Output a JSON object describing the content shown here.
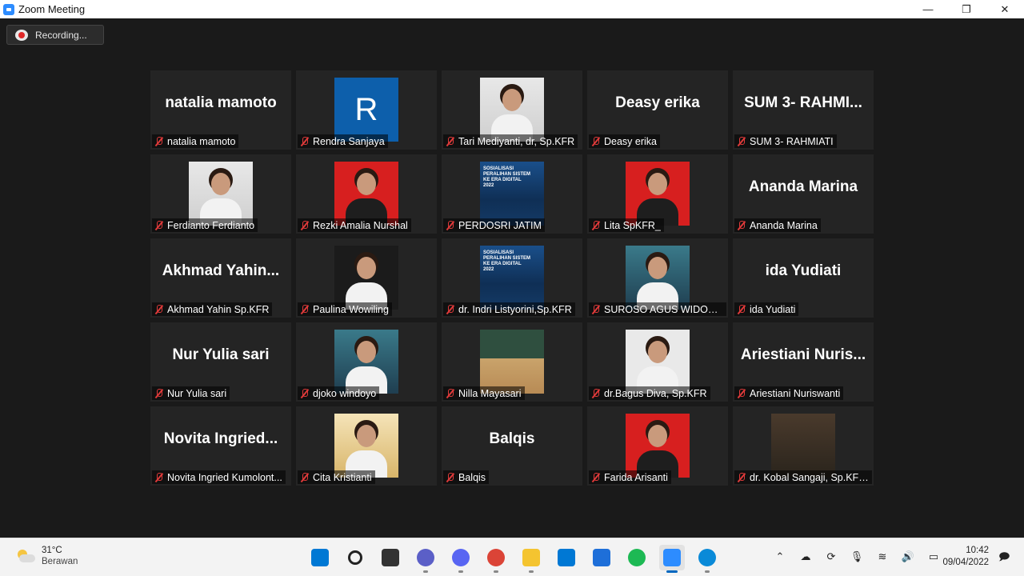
{
  "window": {
    "title": "Zoom Meeting",
    "controls": [
      "—",
      "❐",
      "✕"
    ]
  },
  "recording": {
    "label": "Recording..."
  },
  "participants": [
    {
      "display": "natalia mamoto",
      "name": "natalia mamoto",
      "tile": "text"
    },
    {
      "display": "R",
      "name": "Rendra Sanjaya",
      "tile": "letter"
    },
    {
      "display": "",
      "name": "Tari Mediyanti, dr, Sp.KFR",
      "tile": "photo"
    },
    {
      "display": "Deasy erika",
      "name": "Deasy erika",
      "tile": "text"
    },
    {
      "display": "SUM 3- RAHMI...",
      "name": "SUM 3- RAHMIATI",
      "tile": "text"
    },
    {
      "display": "",
      "name": "Ferdianto Ferdianto",
      "tile": "photo"
    },
    {
      "display": "",
      "name": "Rezki Amalia Nurshal",
      "tile": "photo"
    },
    {
      "display": "",
      "name": "PERDOSRI JATIM",
      "tile": "photo"
    },
    {
      "display": "",
      "name": "Lita SpKFR_",
      "tile": "photo"
    },
    {
      "display": "Ananda Marina",
      "name": "Ananda Marina",
      "tile": "text"
    },
    {
      "display": "Akhmad Yahin...",
      "name": "Akhmad Yahin Sp.KFR",
      "tile": "text"
    },
    {
      "display": "",
      "name": "Paulina Wowiling",
      "tile": "photo"
    },
    {
      "display": "",
      "name": "dr. Indri Listyorini,Sp.KFR",
      "tile": "photo"
    },
    {
      "display": "",
      "name": "SUROSO AGUS WIDODO,...",
      "tile": "photo"
    },
    {
      "display": "ida Yudiati",
      "name": "ida Yudiati",
      "tile": "text"
    },
    {
      "display": "Nur Yulia sari",
      "name": "Nur Yulia sari",
      "tile": "text"
    },
    {
      "display": "",
      "name": "djoko windoyo",
      "tile": "photo"
    },
    {
      "display": "",
      "name": "Nilla Mayasari",
      "tile": "photo"
    },
    {
      "display": "",
      "name": "dr.Bagus Diva, Sp.KFR",
      "tile": "photo"
    },
    {
      "display": "Ariestiani Nuris...",
      "name": "Ariestiani Nuriswanti",
      "tile": "text"
    },
    {
      "display": "Novita Ingried...",
      "name": "Novita Ingried Kumolont...",
      "tile": "text"
    },
    {
      "display": "",
      "name": "Cita Kristianti",
      "tile": "photo"
    },
    {
      "display": "Balqis",
      "name": "Balqis",
      "tile": "text"
    },
    {
      "display": "",
      "name": "Farida Arisanti",
      "tile": "photo"
    },
    {
      "display": "",
      "name": "dr. Kobal Sangaji, Sp.KFR....",
      "tile": "photo"
    }
  ],
  "poster": {
    "text": "SOSIALISASI PERALIHAN SISTEM KE ERA DIGITAL 2022"
  },
  "taskbar": {
    "weather": {
      "temp": "31°C",
      "condition": "Berawan"
    },
    "apps": [
      {
        "name": "windows-start-icon",
        "color": "#0078d4"
      },
      {
        "name": "search-icon",
        "color": "#222222"
      },
      {
        "name": "task-view-icon",
        "color": "#333333"
      },
      {
        "name": "teams-chat-icon",
        "color": "#5b5fc7"
      },
      {
        "name": "discord-icon",
        "color": "#5865f2"
      },
      {
        "name": "chrome-icon",
        "color": "#db4437"
      },
      {
        "name": "file-explorer-icon",
        "color": "#f4c430"
      },
      {
        "name": "mail-icon",
        "color": "#0078d4"
      },
      {
        "name": "store-icon",
        "color": "#1e6fd9"
      },
      {
        "name": "spotify-icon",
        "color": "#1db954"
      },
      {
        "name": "zoom-icon",
        "color": "#2d8cff"
      },
      {
        "name": "edge-icon",
        "color": "#0a8ad8"
      }
    ],
    "clock": {
      "time": "10:42",
      "date": "09/04/2022"
    }
  }
}
